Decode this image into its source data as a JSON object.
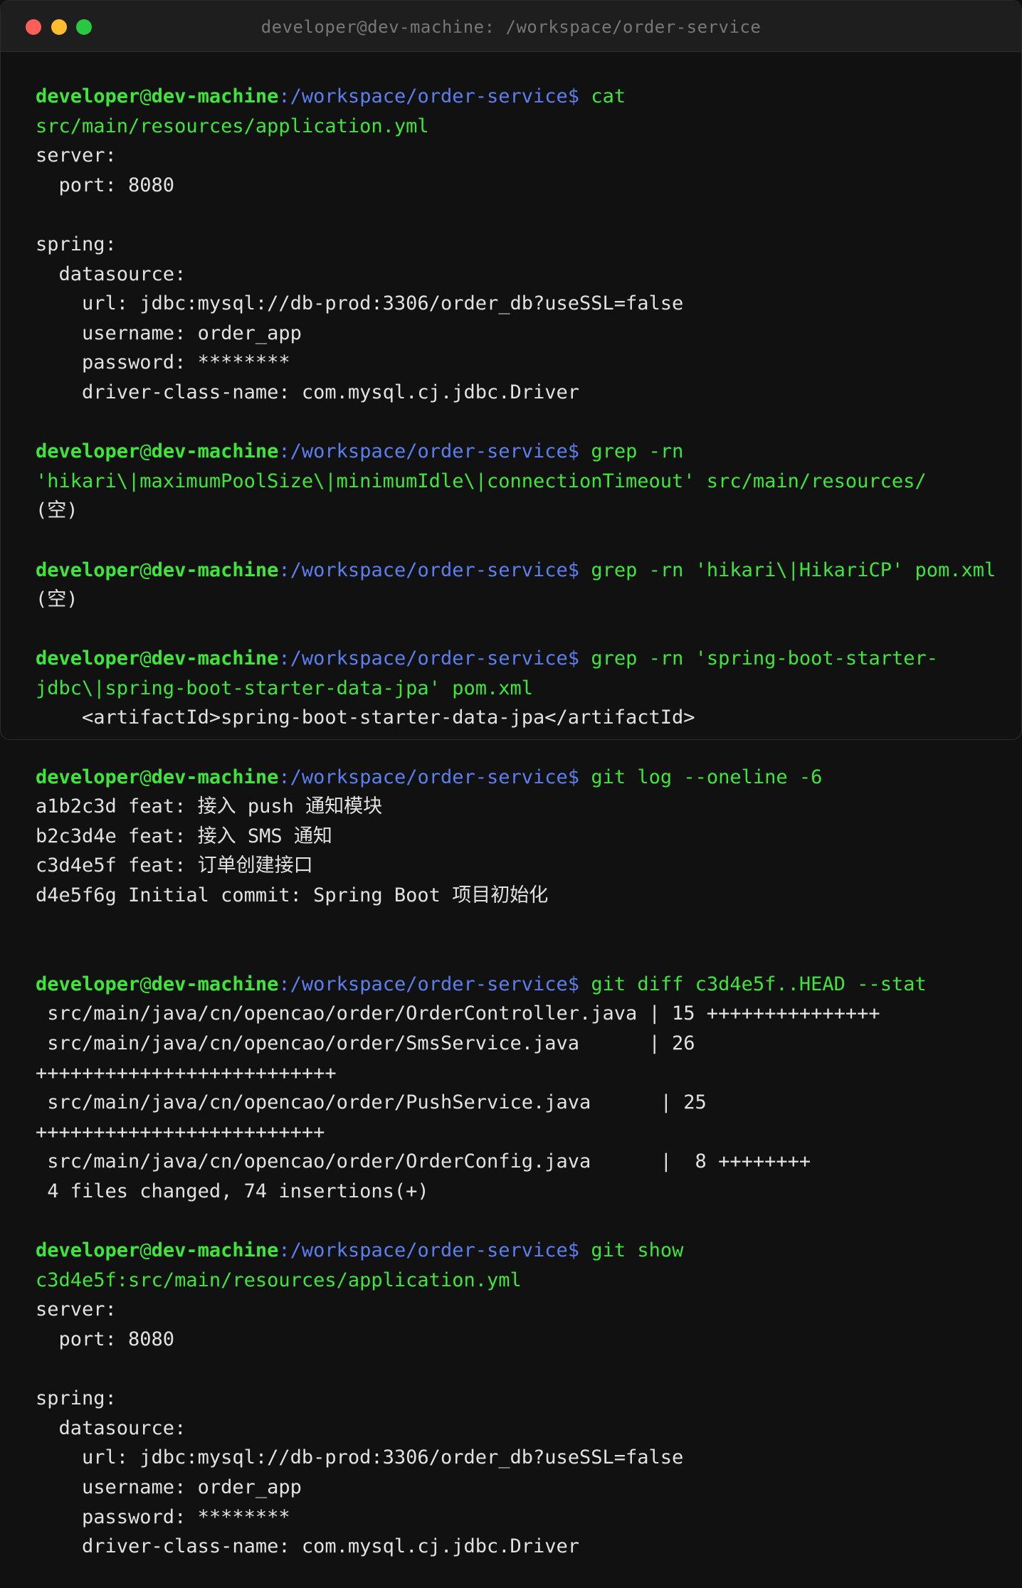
{
  "window": {
    "title": "developer@dev-machine: /workspace/order-service"
  },
  "prompt": {
    "user": "developer",
    "at": "@",
    "host": "dev-machine",
    "colon": ":",
    "path": "/workspace/order-service",
    "dollar": "$"
  },
  "colors": {
    "prompt_user": "#3ee63a",
    "prompt_path": "#5b7ff0",
    "command": "#3ee63a",
    "output": "#e2e2e2",
    "background": "#111111"
  },
  "lines": [
    {
      "type": "prompt",
      "cmd": "cat"
    },
    {
      "type": "cmd",
      "text": "src/main/resources/application.yml"
    },
    {
      "type": "out",
      "text": "server:"
    },
    {
      "type": "out",
      "text": "  port: 8080"
    },
    {
      "type": "out",
      "text": ""
    },
    {
      "type": "out",
      "text": "spring:"
    },
    {
      "type": "out",
      "text": "  datasource:"
    },
    {
      "type": "out",
      "text": "    url: jdbc:mysql://db-prod:3306/order_db?useSSL=false"
    },
    {
      "type": "out",
      "text": "    username: order_app"
    },
    {
      "type": "out",
      "text": "    password: ********"
    },
    {
      "type": "out",
      "text": "    driver-class-name: com.mysql.cj.jdbc.Driver"
    },
    {
      "type": "out",
      "text": ""
    },
    {
      "type": "prompt",
      "cmd": "grep -rn"
    },
    {
      "type": "cmd",
      "text": "'hikari\\|maximumPoolSize\\|minimumIdle\\|connectionTimeout' src/main/resources/"
    },
    {
      "type": "out",
      "text": "(空)"
    },
    {
      "type": "out",
      "text": ""
    },
    {
      "type": "prompt",
      "cmd": "grep -rn 'hikari\\|HikariCP' pom.xml"
    },
    {
      "type": "out",
      "text": "(空)"
    },
    {
      "type": "out",
      "text": ""
    },
    {
      "type": "prompt",
      "cmd": "grep -rn 'spring-boot-starter-"
    },
    {
      "type": "cmd",
      "text": "jdbc\\|spring-boot-starter-data-jpa' pom.xml"
    },
    {
      "type": "out",
      "text": "    <artifactId>spring-boot-starter-data-jpa</artifactId>"
    },
    {
      "type": "out",
      "text": ""
    },
    {
      "type": "prompt",
      "cmd": "git log --oneline -6"
    },
    {
      "type": "out",
      "text": "a1b2c3d feat: 接入 push 通知模块"
    },
    {
      "type": "out",
      "text": "b2c3d4e feat: 接入 SMS 通知"
    },
    {
      "type": "out",
      "text": "c3d4e5f feat: 订单创建接口"
    },
    {
      "type": "out",
      "text": "d4e5f6g Initial commit: Spring Boot 项目初始化"
    },
    {
      "type": "out",
      "text": ""
    },
    {
      "type": "out",
      "text": ""
    },
    {
      "type": "prompt",
      "cmd": "git diff c3d4e5f..HEAD --stat"
    },
    {
      "type": "out",
      "text": " src/main/java/cn/opencao/order/OrderController.java | 15 +++++++++++++++"
    },
    {
      "type": "out",
      "text": " src/main/java/cn/opencao/order/SmsService.java      | 26"
    },
    {
      "type": "out",
      "text": "++++++++++++++++++++++++++"
    },
    {
      "type": "out",
      "text": " src/main/java/cn/opencao/order/PushService.java      | 25"
    },
    {
      "type": "out",
      "text": "+++++++++++++++++++++++++"
    },
    {
      "type": "out",
      "text": " src/main/java/cn/opencao/order/OrderConfig.java      |  8 ++++++++"
    },
    {
      "type": "out",
      "text": " 4 files changed, 74 insertions(+)"
    },
    {
      "type": "out",
      "text": ""
    },
    {
      "type": "prompt",
      "cmd": "git show"
    },
    {
      "type": "cmd",
      "text": "c3d4e5f:src/main/resources/application.yml"
    },
    {
      "type": "out",
      "text": "server:"
    },
    {
      "type": "out",
      "text": "  port: 8080"
    },
    {
      "type": "out",
      "text": ""
    },
    {
      "type": "out",
      "text": "spring:"
    },
    {
      "type": "out",
      "text": "  datasource:"
    },
    {
      "type": "out",
      "text": "    url: jdbc:mysql://db-prod:3306/order_db?useSSL=false"
    },
    {
      "type": "out",
      "text": "    username: order_app"
    },
    {
      "type": "out",
      "text": "    password: ********"
    },
    {
      "type": "out",
      "text": "    driver-class-name: com.mysql.cj.jdbc.Driver"
    }
  ]
}
